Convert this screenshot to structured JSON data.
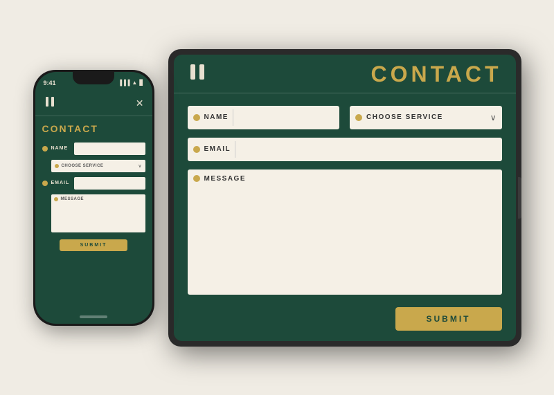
{
  "app": {
    "logo_symbol": "nh",
    "title": "CONTACT"
  },
  "phone": {
    "time": "9:41",
    "status_icons": "▐▐▐",
    "logo": "nh",
    "close_icon": "✕",
    "title": "CONTACT",
    "name_label": "NAME",
    "service_label": "CHOOSE SERVICE",
    "email_label": "EMAIL",
    "message_label": "MESSAGE",
    "submit_label": "SUBMIT",
    "home_circle": "○"
  },
  "tablet": {
    "logo": "nh",
    "title": "CONTACT",
    "name_label": "NAME",
    "service_label": "CHOOSE SERVICE",
    "email_label": "EMAIL",
    "message_label": "MESSAGE",
    "submit_label": "SUBMIT",
    "arrow_icon": "∨"
  }
}
